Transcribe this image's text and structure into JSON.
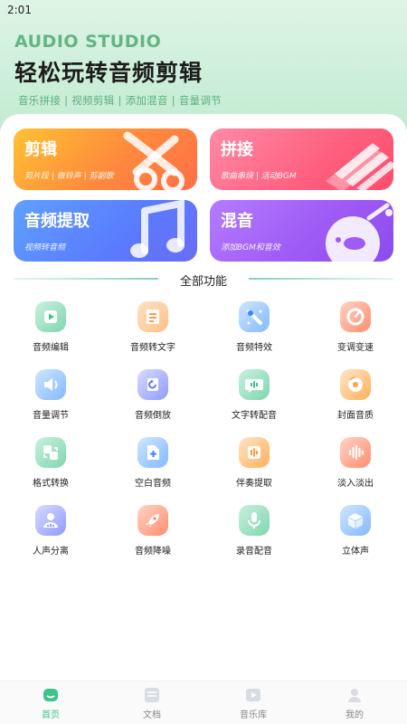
{
  "status_bar": {
    "time": "2:01"
  },
  "header": {
    "brand": "AUDIO STUDIO",
    "slogan": "轻松玩转音频剪辑",
    "tags": "音乐拼接 | 视频剪辑 | 添加混音 | 音量调节"
  },
  "feature_cards": [
    {
      "title": "剪辑",
      "subtitle": "剪片段 | 做铃声 | 剪副歌",
      "icon": "scissors-icon",
      "color": "#ff8a3d"
    },
    {
      "title": "拼接",
      "subtitle": "歌曲串烧 | 活动BGM",
      "icon": "ribbon-stripes-icon",
      "color": "#ff5f7e"
    },
    {
      "title": "音频提取",
      "subtitle": "视频转音频",
      "icon": "music-note-icon",
      "color": "#5a7bff"
    },
    {
      "title": "混音",
      "subtitle": "添加BGM和音效",
      "icon": "mixer-disc-icon",
      "color": "#9f5bf5"
    }
  ],
  "section": {
    "title": "全部功能"
  },
  "tools": [
    {
      "label": "音频编辑",
      "icon": "play-box-icon"
    },
    {
      "label": "音频转文字",
      "icon": "document-icon"
    },
    {
      "label": "音频特效",
      "icon": "magic-wand-icon"
    },
    {
      "label": "变调变速",
      "icon": "speed-dial-icon"
    },
    {
      "label": "音量调节",
      "icon": "volume-icon"
    },
    {
      "label": "音频倒放",
      "icon": "rewind-icon"
    },
    {
      "label": "文字转配音",
      "icon": "chat-waveform-icon"
    },
    {
      "label": "封面音质",
      "icon": "disc-icon"
    },
    {
      "label": "格式转换",
      "icon": "convert-icon"
    },
    {
      "label": "空白音频",
      "icon": "add-file-icon"
    },
    {
      "label": "伴奏提取",
      "icon": "extract-icon"
    },
    {
      "label": "淡入淡出",
      "icon": "waveform-icon"
    },
    {
      "label": "人声分离",
      "icon": "voice-separate-icon"
    },
    {
      "label": "音频降噪",
      "icon": "rocket-icon"
    },
    {
      "label": "录音配音",
      "icon": "microphone-icon"
    },
    {
      "label": "立体声",
      "icon": "cube-icon"
    }
  ],
  "bottom_nav": [
    {
      "label": "首页",
      "icon": "home-icon",
      "active": true
    },
    {
      "label": "文档",
      "icon": "document-list-icon",
      "active": false
    },
    {
      "label": "音乐库",
      "icon": "music-library-icon",
      "active": false
    },
    {
      "label": "我的",
      "icon": "profile-icon",
      "active": false
    }
  ],
  "colors": {
    "accent": "#3cc48a",
    "brand_green": "#64b584"
  }
}
